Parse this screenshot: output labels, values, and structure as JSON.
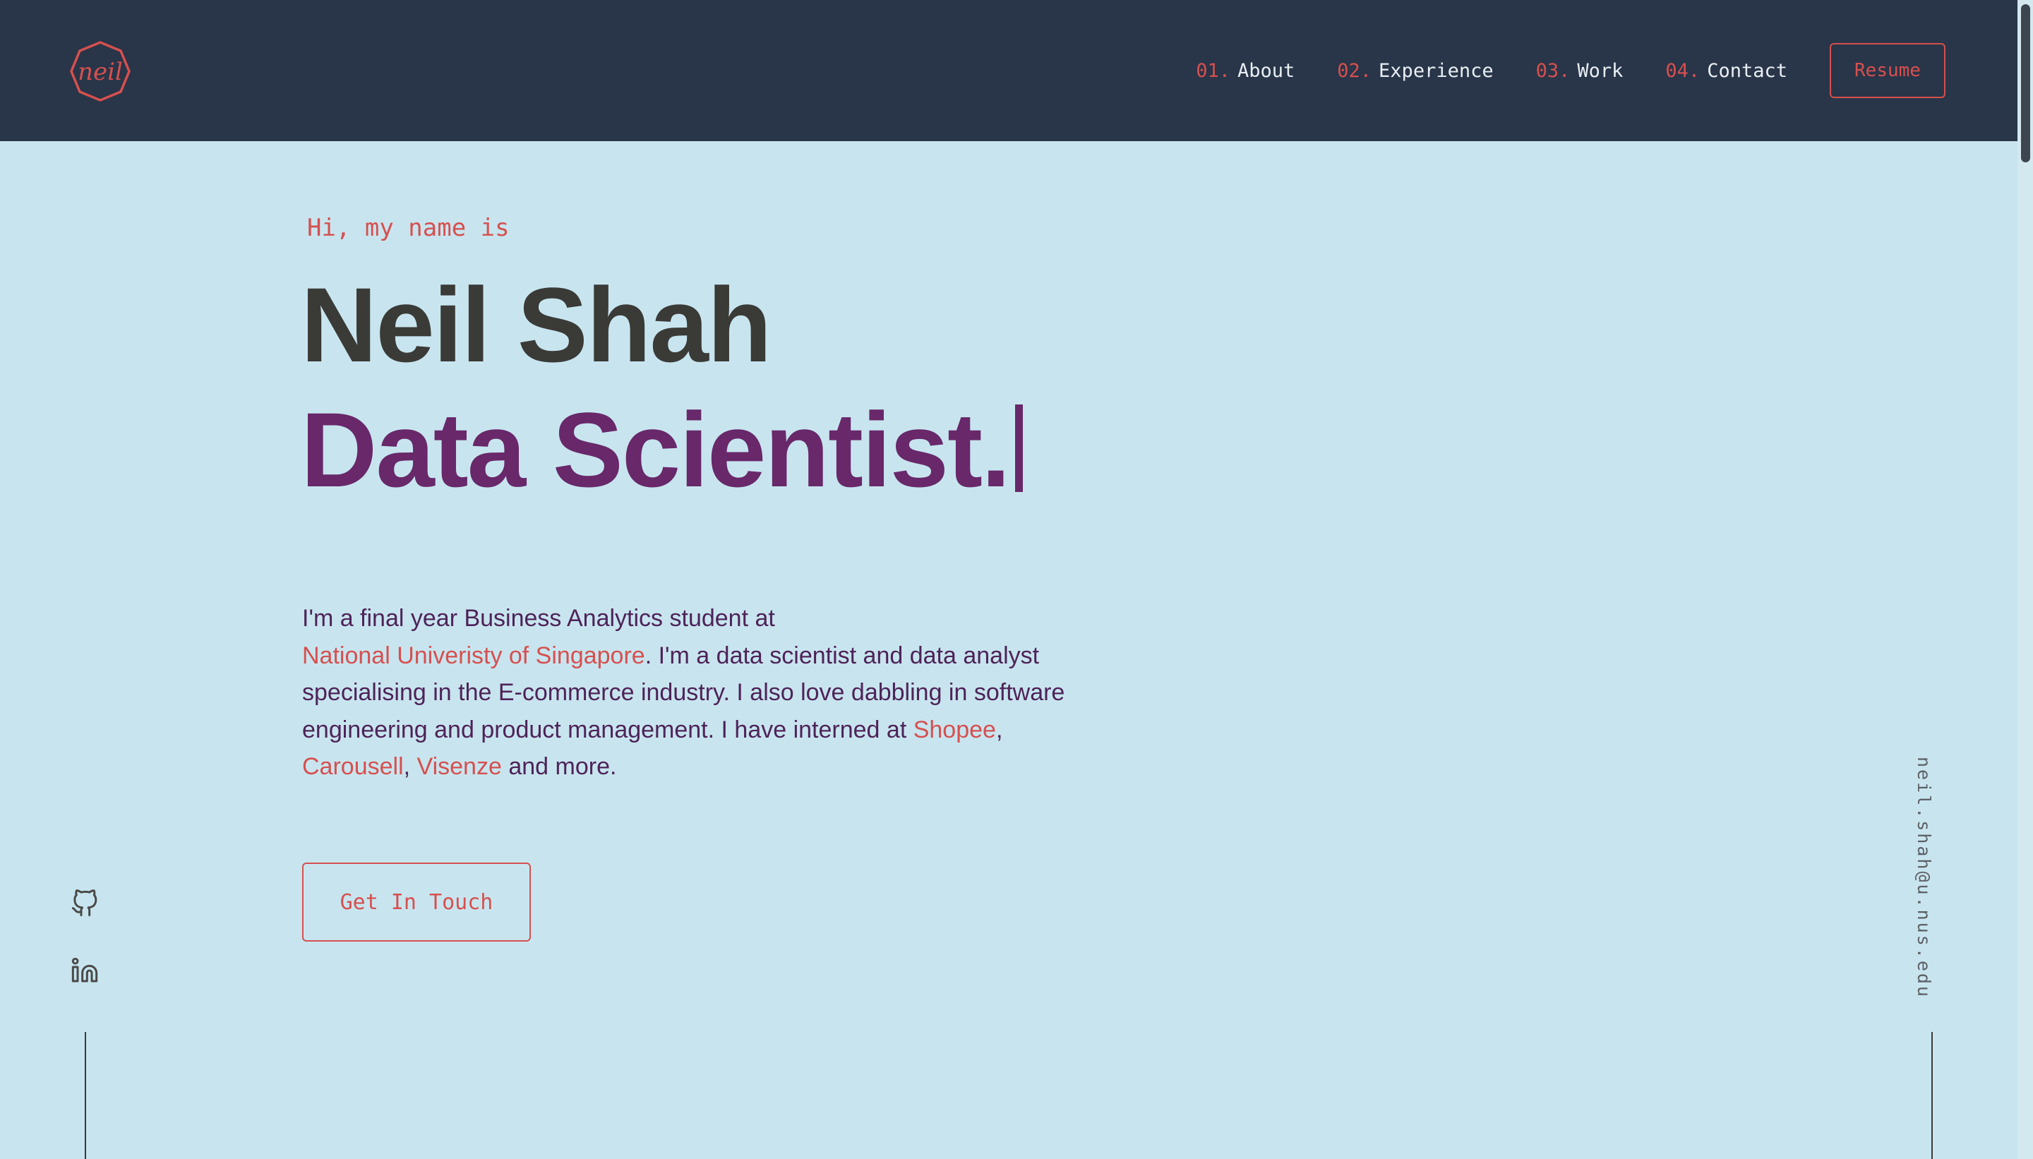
{
  "header": {
    "logo_text": "neil",
    "nav": [
      {
        "num": "01.",
        "label": "About"
      },
      {
        "num": "02.",
        "label": "Experience"
      },
      {
        "num": "03.",
        "label": "Work"
      },
      {
        "num": "04.",
        "label": "Contact"
      }
    ],
    "resume_label": "Resume"
  },
  "hero": {
    "greeting": "Hi, my name is",
    "name": "Neil Shah",
    "role": "Data Scientist.",
    "bio": {
      "p1": "I'm a final year Business Analytics student at",
      "university": "National Univeristy of Singapore",
      "p2": ". I'm a data scientist and data analyst specialising in the E-commerce industry. I also love dabbling in software engineering and product management. I have interned at",
      "company1": "Shopee",
      "comma1": ",",
      "company2": "Carousell",
      "comma2": ",",
      "company3": "Visenze",
      "p3": "and more."
    },
    "cta_label": "Get In Touch"
  },
  "side": {
    "email": "neil.shah@u.nus.edu",
    "icons": [
      "github-icon",
      "linkedin-icon"
    ]
  },
  "colors": {
    "background": "#c8e5ef",
    "header": "#293548",
    "accent": "#d6504f",
    "role": "#68286a",
    "name": "#3a3a37",
    "body_text": "#4e2358"
  }
}
